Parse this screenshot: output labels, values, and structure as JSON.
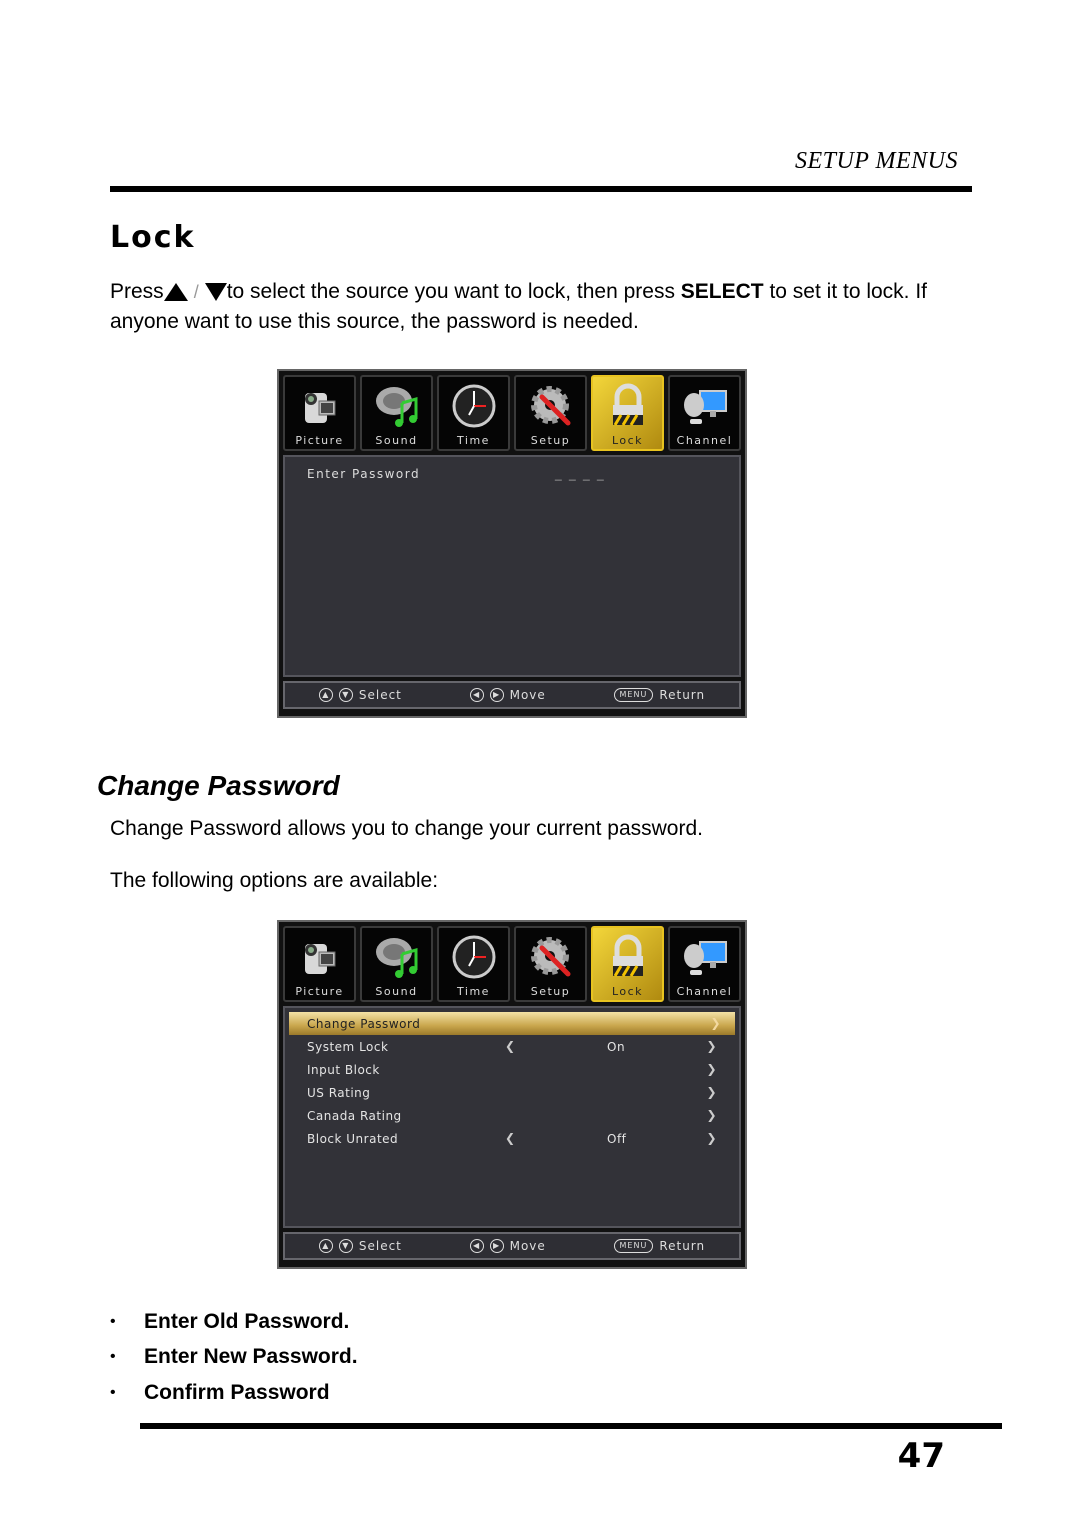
{
  "header": {
    "section": "SETUP MENUS"
  },
  "lock": {
    "title": "Lock",
    "intro": {
      "prefix": "Press",
      "up_icon": "triangle-up-icon",
      "sep": "/",
      "down_icon": "triangle-down-icon",
      "middle": "to select the source you want to lock, then press ",
      "bold": "SELECT",
      "suffix": " to set it to lock. If anyone want to use this source, the password is needed."
    },
    "screen": {
      "tabs": [
        {
          "label": "Picture",
          "icon": "camcorder-icon",
          "active": false
        },
        {
          "label": "Sound",
          "icon": "speaker-music-icon",
          "active": false
        },
        {
          "label": "Time",
          "icon": "clock-icon",
          "active": false
        },
        {
          "label": "Setup",
          "icon": "gear-screwdriver-icon",
          "active": false
        },
        {
          "label": "Lock",
          "icon": "padlock-icon",
          "active": true
        },
        {
          "label": "Channel",
          "icon": "satellite-monitor-icon",
          "active": false
        }
      ],
      "password_label": "Enter Password",
      "password_mask": "_ _ _ _",
      "footer": {
        "select": "Select",
        "move": "Move",
        "menu_key": "MENU",
        "return": "Return"
      }
    }
  },
  "change_password": {
    "title": "Change Password",
    "description": "Change Password allows you to change your current password.",
    "options_intro": "The following options are available:",
    "screen": {
      "tabs": [
        {
          "label": "Picture",
          "icon": "camcorder-icon",
          "active": false
        },
        {
          "label": "Sound",
          "icon": "speaker-music-icon",
          "active": false
        },
        {
          "label": "Time",
          "icon": "clock-icon",
          "active": false
        },
        {
          "label": "Setup",
          "icon": "gear-screwdriver-icon",
          "active": false
        },
        {
          "label": "Lock",
          "icon": "padlock-icon",
          "active": true
        },
        {
          "label": "Channel",
          "icon": "satellite-monitor-icon",
          "active": false
        }
      ],
      "items": [
        {
          "label": "Change Password",
          "value": "",
          "left_arrow": false,
          "selected": true
        },
        {
          "label": "System Lock",
          "value": "On",
          "left_arrow": true,
          "selected": false
        },
        {
          "label": "Input Block",
          "value": "",
          "left_arrow": false,
          "selected": false
        },
        {
          "label": "US Rating",
          "value": "",
          "left_arrow": false,
          "selected": false
        },
        {
          "label": "Canada Rating",
          "value": "",
          "left_arrow": false,
          "selected": false
        },
        {
          "label": "Block Unrated",
          "value": "Off",
          "left_arrow": true,
          "selected": false
        }
      ],
      "footer": {
        "select": "Select",
        "move": "Move",
        "menu_key": "MENU",
        "return": "Return"
      }
    },
    "bullets": [
      "Enter Old Password.",
      "Enter New Password.",
      "Confirm Password"
    ]
  },
  "page_number": "47",
  "colors": {
    "active_tab": "#e8c320",
    "panel_bg": "#323238",
    "selected_row": "#c9a64c"
  }
}
